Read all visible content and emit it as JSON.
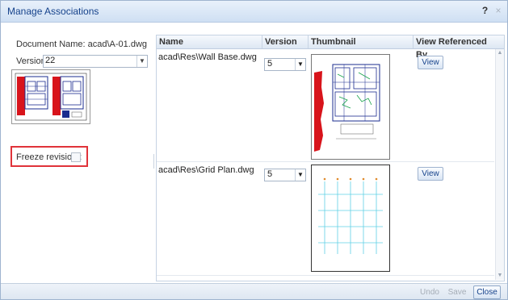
{
  "window": {
    "title": "Manage Associations",
    "help_glyph": "?",
    "close_glyph": "×"
  },
  "document": {
    "name_label": "Document Name: acad\\A-01.dwg"
  },
  "version_field": {
    "label": "Version:",
    "value": "22"
  },
  "freeze": {
    "label": "Freeze revision :",
    "checked": false
  },
  "grid": {
    "columns": [
      "Name",
      "Version",
      "Thumbnail",
      "View Referenced By"
    ],
    "rows": [
      {
        "name": "acad\\Res\\Wall Base.dwg",
        "version": "5",
        "view_label": "View",
        "thumbnail": "wall-base-drawing"
      },
      {
        "name": "acad\\Res\\Grid Plan.dwg",
        "version": "5",
        "view_label": "View",
        "thumbnail": "grid-plan-drawing"
      }
    ]
  },
  "footer": {
    "undo": "Undo",
    "save": "Save",
    "close": "Close"
  },
  "colors": {
    "accent": "#15428b",
    "highlight_border": "#e0333a",
    "drawing_red": "#d8141b",
    "drawing_cyan": "#5fd0e6"
  }
}
